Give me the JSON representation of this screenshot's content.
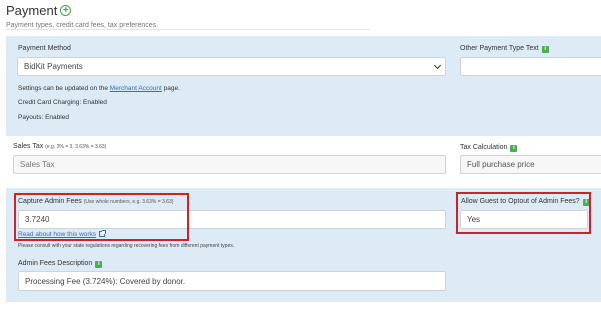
{
  "header": {
    "title": "Payment",
    "subtitle": "Payment types, credit card fees, tax preferences."
  },
  "payment_section": {
    "method_label": "Payment Method",
    "method_value": "BidKit Payments",
    "settings_prefix": "Settings can be updated on the ",
    "settings_link": "Merchant Account",
    "settings_suffix": " page.",
    "credit_charging": "Credit Card Charging: Enabled",
    "payouts": "Payouts: Enabled",
    "other_type_label": "Other Payment Type Text",
    "other_type_value": ""
  },
  "tax_section": {
    "sales_tax_label": "Sales Tax",
    "sales_tax_hint": "(e.g. 3% = 3, 3.63% = 3.63)",
    "sales_tax_placeholder": "Sales Tax",
    "calc_label": "Tax Calculation",
    "calc_value": "Full purchase price"
  },
  "admin_fees": {
    "capture_label": "Capture Admin Fees",
    "capture_hint": "(Use whole numbers, e.g. 3.63% = 3.63)",
    "capture_value": "3.7240",
    "read_more": "Read about how this works",
    "note": "Please consult with your state regulations regarding recovering fees from different payment types.",
    "optout_label": "Allow Guest to Optout of Admin Fees?",
    "optout_value": "Yes",
    "description_label": "Admin Fees Description",
    "description_value": "Processing Fee (3.724%): Covered by donor."
  },
  "colors": {
    "panel_bg": "#dcebf6",
    "highlight": "#d0202a",
    "info_green": "#4cae4c",
    "link_blue": "#2a72c4"
  },
  "icons": [
    "plus-circle-icon",
    "info-icon",
    "chevron-down-icon",
    "external-link-icon"
  ]
}
